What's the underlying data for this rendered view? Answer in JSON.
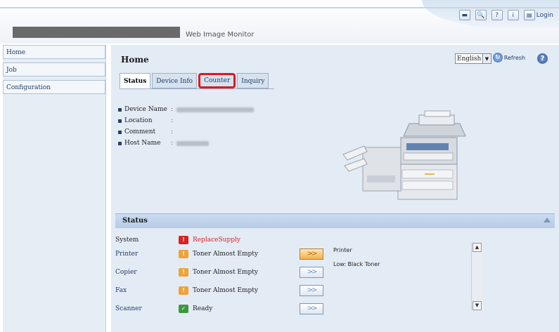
{
  "header": {
    "brand": "Web Image Monitor",
    "icons": [
      {
        "name": "keyboard-icon",
        "glyph": "▬"
      },
      {
        "name": "search-icon",
        "glyph": "🔍"
      },
      {
        "name": "help-icon",
        "glyph": "?"
      },
      {
        "name": "info-icon",
        "glyph": "i"
      }
    ],
    "login_label": "Login"
  },
  "nav": {
    "items": [
      "Home",
      "Job",
      "Configuration"
    ]
  },
  "main": {
    "title": "Home",
    "language": "English",
    "refresh_label": "Refresh",
    "help_glyph": "?",
    "tabs": [
      "Status",
      "Device Info",
      "Counter",
      "Inquiry"
    ],
    "active_tab": "Status",
    "highlighted_tab": "Counter",
    "info": [
      {
        "label": "Device Name",
        "value_hidden": true
      },
      {
        "label": "Location",
        "value_hidden": false
      },
      {
        "label": "Comment",
        "value_hidden": false
      },
      {
        "label": "Host Name",
        "value_hidden": true
      }
    ]
  },
  "status": {
    "title": "Status",
    "rows": [
      {
        "name": "System",
        "link": false,
        "icon": "red",
        "glyph": "!",
        "text": "ReplaceSupply",
        "text_color": "red",
        "button": false
      },
      {
        "name": "Printer",
        "link": true,
        "icon": "orange",
        "glyph": "!",
        "text": "Toner Almost Empty",
        "button": true,
        "button_active": true
      },
      {
        "name": "Copier",
        "link": true,
        "icon": "orange",
        "glyph": "!",
        "text": "Toner Almost Empty",
        "button": true,
        "button_active": false
      },
      {
        "name": "Fax",
        "link": true,
        "icon": "orange",
        "glyph": "!",
        "text": "Toner Almost Empty",
        "button": true,
        "button_active": false
      },
      {
        "name": "Scanner",
        "link": true,
        "icon": "green",
        "glyph": "✓",
        "text": "Ready",
        "button": true,
        "button_active": false
      }
    ],
    "message_title": "Printer",
    "message_text": "Low: Black Toner"
  },
  "colors": {
    "accent_blue": "#1f3b66",
    "alert_red": "#d9231f",
    "warning_orange": "#f0a238",
    "ok_green": "#3a9a3c",
    "highlight_red": "#e0181e"
  }
}
